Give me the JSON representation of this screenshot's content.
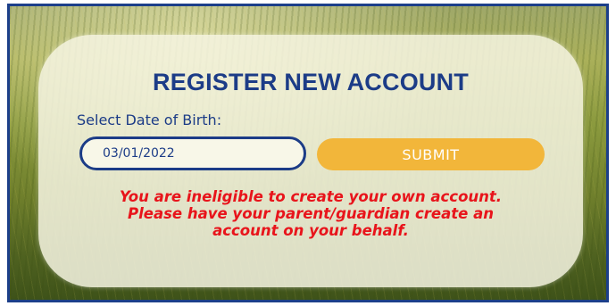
{
  "form": {
    "title": "REGISTER NEW ACCOUNT",
    "dob_label": "Select Date of Birth:",
    "dob_value": "03/01/2022",
    "submit_label": "SUBMIT",
    "error_lines": [
      "You are ineligible to create your own account.",
      "Please have your parent/guardian create an",
      "account on your behalf."
    ]
  },
  "colors": {
    "title": "#1c3c87",
    "input_border": "#1c3c87",
    "submit_bg": "#f2b63a",
    "submit_text": "#ffffff",
    "error": "#e8141b",
    "frame_border": "#1c3f8a"
  }
}
